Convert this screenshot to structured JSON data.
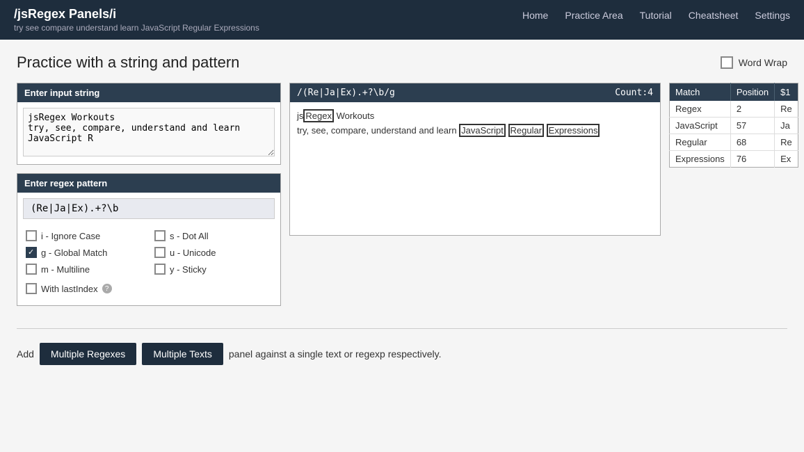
{
  "navbar": {
    "brand": "/jsRegex Panels/i",
    "tagline": "try see compare understand learn JavaScript Regular Expressions",
    "links": [
      "Home",
      "Practice Area",
      "Tutorial",
      "Cheatsheet",
      "Settings"
    ]
  },
  "page": {
    "title": "Practice with a string and pattern",
    "word_wrap_label": "Word Wrap"
  },
  "input_panel": {
    "header": "Enter input string",
    "value": "jsRegex Workouts\ntry, see, compare, understand and learn JavaScript R"
  },
  "regex_panel": {
    "header": "Enter regex pattern",
    "pattern_value": "(Re|Ja|Ex).+?\\b",
    "flags": [
      {
        "id": "flag-i",
        "label": "i - Ignore Case",
        "checked": false
      },
      {
        "id": "flag-s",
        "label": "s - Dot All",
        "checked": false
      },
      {
        "id": "flag-g",
        "label": "g - Global Match",
        "checked": true
      },
      {
        "id": "flag-u",
        "label": "u - Unicode",
        "checked": false
      },
      {
        "id": "flag-m",
        "label": "m - Multiline",
        "checked": false
      },
      {
        "id": "flag-y",
        "label": "y - Sticky",
        "checked": false
      }
    ],
    "last_index_label": "With lastIndex",
    "help_symbol": "?"
  },
  "output_panel": {
    "regex_display": "/(Re|Ja|Ex).+?\\b/g",
    "count_label": "Count:4",
    "text_before_match1": "js",
    "match1": "Regex",
    "text_after_match1": " Workouts",
    "line2_before": "try, see, compare, understand and learn ",
    "match2": "JavaScript",
    "match2_space": " ",
    "match3": "Regular",
    "match3_space": " ",
    "match4": "Expressions",
    "line2_after": ""
  },
  "results_table": {
    "headers": [
      "Match",
      "Position",
      "$1"
    ],
    "rows": [
      {
        "match": "Regex",
        "position": "2",
        "group1": "Re"
      },
      {
        "match": "JavaScript",
        "position": "57",
        "group1": "Ja"
      },
      {
        "match": "Regular",
        "position": "68",
        "group1": "Re"
      },
      {
        "match": "Expressions",
        "position": "76",
        "group1": "Ex"
      }
    ]
  },
  "bottom": {
    "prefix": "Add",
    "btn1_label": "Multiple Regexes",
    "btn2_label": "Multiple Texts",
    "suffix": "panel against a single text or regexp respectively."
  }
}
